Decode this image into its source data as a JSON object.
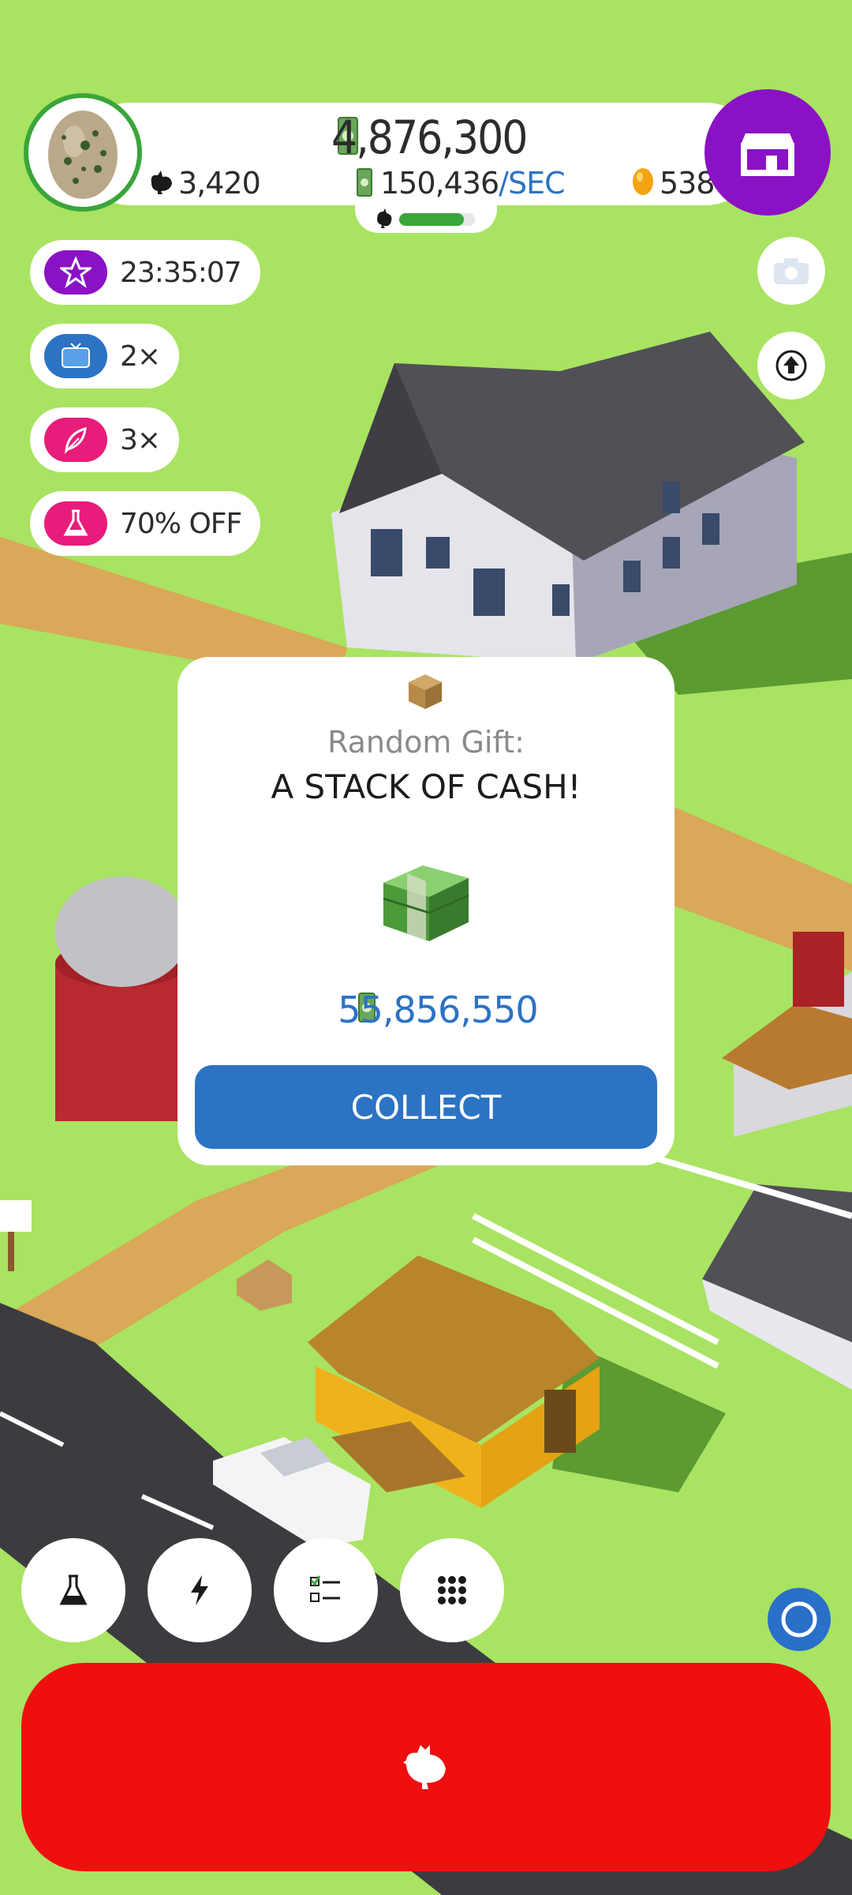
{
  "colors": {
    "grass": "#a9e362",
    "road": "#3c3c40",
    "dirt": "#d9a858",
    "accent_blue": "#2c73c4",
    "shop_purple": "#8a12c4",
    "hatch_red": "#ef0f0f",
    "progress_green": "#3aa53a"
  },
  "header": {
    "cash": "4,876,300",
    "cash_rate": "150,436",
    "cash_rate_unit": "/SEC",
    "chicken_count": "3,420",
    "golden_eggs": "538",
    "progress": 0.85,
    "egg_icon": "speckled-egg-icon",
    "shop_icon": "shop-icon"
  },
  "boosts": [
    {
      "icon": "star-icon",
      "label": "23:35:07",
      "color": "#8a12c4"
    },
    {
      "icon": "tv-icon",
      "label": "2×",
      "color": "#2c73c4"
    },
    {
      "icon": "feather-icon",
      "label": "3×",
      "color": "#e81c7a"
    },
    {
      "icon": "flask-icon",
      "label": "70% OFF",
      "color": "#e81c7a"
    }
  ],
  "side_buttons": {
    "camera_icon": "camera-icon",
    "upgrade_icon": "up-arrow-icon"
  },
  "dialog": {
    "title": "Random Gift:",
    "subtitle": "A STACK OF CASH!",
    "amount": "55,856,550",
    "button": "COLLECT",
    "box_icon": "gift-box-icon",
    "cash_icon": "cash-stack-icon"
  },
  "bottom_nav": [
    {
      "icon": "flask-icon"
    },
    {
      "icon": "lightning-icon"
    },
    {
      "icon": "checklist-icon"
    },
    {
      "icon": "grid-icon"
    }
  ],
  "hatch": {
    "icon": "chicken-icon"
  }
}
